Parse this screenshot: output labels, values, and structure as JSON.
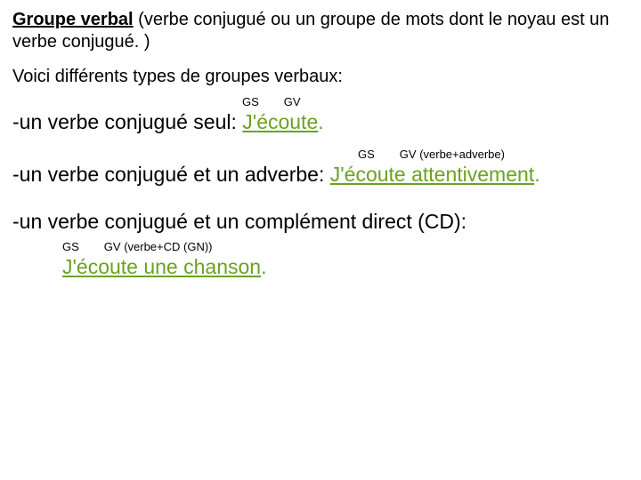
{
  "title": {
    "term": "Groupe verbal",
    "definition_part1": " (verbe conjugué ou un groupe de mots dont le noyau est un",
    "definition_part2": "verbe conjugué. )"
  },
  "intro": "Voici différents types de groupes verbaux:",
  "ex1": {
    "annot_gs": "GS",
    "annot_gv": "GV",
    "lead": "-un verbe conjugué seul: ",
    "gs": "J'",
    "gv": "écoute",
    "end": "."
  },
  "ex2": {
    "annot_gs": "GS",
    "annot_gv": "GV (verbe+adverbe)",
    "lead": "-un verbe conjugué et un adverbe: ",
    "gs": "J'",
    "gv": "écoute attentivement",
    "end": "."
  },
  "ex3": {
    "lead": "-un verbe conjugué et un complément direct (CD):",
    "annot_gs": "GS",
    "annot_gv": "GV (verbe+CD (GN))",
    "gs": "J'",
    "gv": "écoute une chanson",
    "end": "."
  }
}
